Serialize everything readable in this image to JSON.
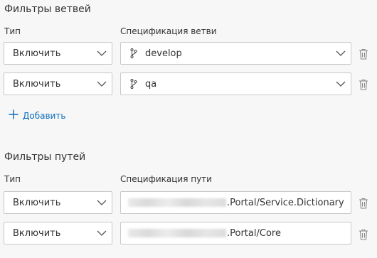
{
  "branch_filters": {
    "title": "Фильтры ветвей",
    "type_label": "Тип",
    "spec_label": "Спецификация ветви",
    "rows": [
      {
        "type": "Включить",
        "branch": "develop"
      },
      {
        "type": "Включить",
        "branch": "qa"
      }
    ],
    "add_label": "Добавить"
  },
  "path_filters": {
    "title": "Фильтры путей",
    "type_label": "Тип",
    "spec_label": "Спецификация пути",
    "rows": [
      {
        "type": "Включить",
        "path_suffix": ".Portal/Service.Dictionary"
      },
      {
        "type": "Включить",
        "path_suffix": ".Portal/Core"
      }
    ]
  },
  "icons": {
    "branch": "branch-icon",
    "chevron": "chevron-down-icon",
    "delete": "trash-icon",
    "add": "plus-icon"
  },
  "colors": {
    "accent": "#0b6cbc",
    "border": "#c8c8c8",
    "background": "#f7f7f7"
  }
}
